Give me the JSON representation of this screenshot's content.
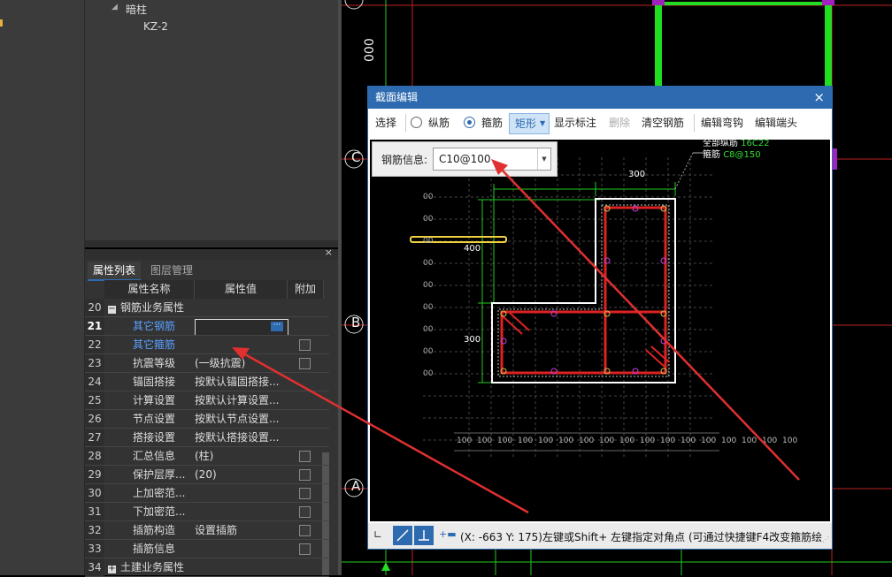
{
  "tree": {
    "node_label": "暗柱",
    "child_label": "KZ-2"
  },
  "property_panel": {
    "tabs": [
      "属性列表",
      "图层管理"
    ],
    "headers": {
      "name": "属性名称",
      "value": "属性值",
      "extra": "附加"
    },
    "rows": [
      {
        "num": "20",
        "name": "钢筋业务属性",
        "value": "",
        "group": true,
        "expand": "−",
        "check": false
      },
      {
        "num": "21",
        "name": "其它钢筋",
        "value": "",
        "link": true,
        "editing": true,
        "check": false
      },
      {
        "num": "22",
        "name": "其它箍筋",
        "value": "",
        "link": true,
        "check": true
      },
      {
        "num": "23",
        "name": "抗震等级",
        "value": "(一级抗震)",
        "check": true
      },
      {
        "num": "24",
        "name": "锚固搭接",
        "value": "按默认锚固搭接...",
        "check": false
      },
      {
        "num": "25",
        "name": "计算设置",
        "value": "按默认计算设置...",
        "check": false
      },
      {
        "num": "26",
        "name": "节点设置",
        "value": "按默认节点设置...",
        "check": false
      },
      {
        "num": "27",
        "name": "搭接设置",
        "value": "按默认搭接设置...",
        "check": false
      },
      {
        "num": "28",
        "name": "汇总信息",
        "value": "(柱)",
        "check": true
      },
      {
        "num": "29",
        "name": "保护层厚...",
        "value": "(20)",
        "check": true
      },
      {
        "num": "30",
        "name": "上加密范...",
        "value": "",
        "check": true
      },
      {
        "num": "31",
        "name": "下加密范...",
        "value": "",
        "check": true
      },
      {
        "num": "32",
        "name": "插筋构造",
        "value": "设置插筋",
        "check": true
      },
      {
        "num": "33",
        "name": "插筋信息",
        "value": "",
        "check": true
      },
      {
        "num": "34",
        "name": "土建业务属性",
        "value": "",
        "group": true,
        "expand": "+",
        "check": false
      }
    ]
  },
  "cad": {
    "axis_labels": [
      "C",
      "B",
      "A"
    ],
    "dim_text": "000"
  },
  "dialog": {
    "title": "截面编辑",
    "close": "×",
    "toolbar": {
      "select": "选择",
      "radio_long": "纵筋",
      "radio_stirrup": "箍筋",
      "shape": "矩形",
      "show_marks": "显示标注",
      "delete": "删除",
      "clear": "清空钢筋",
      "edit_hook": "编辑弯钩",
      "edit_end": "编辑端头"
    },
    "rebar_info": {
      "label": "钢筋信息:",
      "value": "C10@100"
    },
    "legend": [
      {
        "name": "全部纵筋",
        "value": "16C22"
      },
      {
        "name": "箍筋",
        "value": "C8@150"
      }
    ],
    "dims": {
      "top_left": "400",
      "top_right": "300",
      "left_top": "400",
      "left_bottom": "300"
    },
    "scale_labels": [
      "100",
      "100",
      "100",
      "100",
      "100",
      "100",
      "100",
      "100",
      "100",
      "100",
      "100",
      "100",
      "100",
      "100",
      "100",
      "100",
      "100"
    ],
    "side_labels": [
      "00",
      "00",
      "00",
      "00",
      "00",
      "00",
      "00",
      "00",
      "00"
    ],
    "status_text": "(X: -663 Y: 175)左键或Shift+ 左键指定对角点 (可通过快捷键F4改变箍筋绘"
  },
  "colors": {
    "dialog_blue": "#2d6ab0",
    "rebar_red": "#dd2222",
    "dim_green": "#22dd22",
    "arrow_red": "#e03030"
  }
}
